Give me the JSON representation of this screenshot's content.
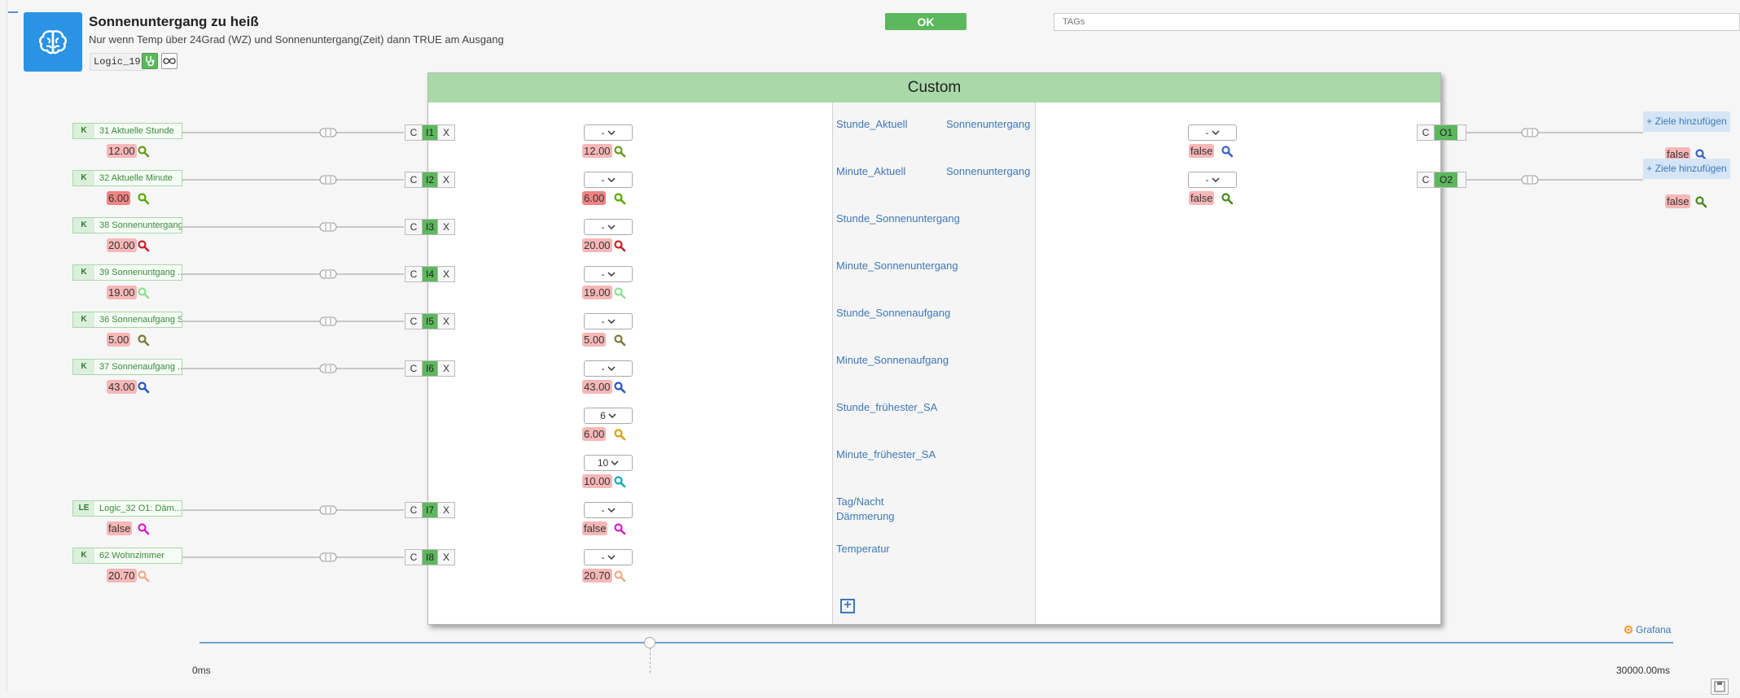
{
  "header": {
    "title": "Sonnenuntergang zu heiß",
    "description": "Nur wenn Temp über 24Grad (WZ) und Sonnenuntergang(Zeit) dann TRUE am Ausgang",
    "logic_id": "Logic_19",
    "ok_label": "OK",
    "tags_placeholder": "TAGs"
  },
  "block": {
    "title": "Custom",
    "add_port_icon": "plus-box-icon"
  },
  "colors": {
    "accent_green": "#5cb85c",
    "header_green": "#a9d9a9",
    "link_blue": "#3f78b8",
    "logo_blue": "#2a93e4",
    "value_pink": "#f7b7b7"
  },
  "inputs": [
    {
      "row": 0,
      "src_type": "K",
      "src_label": "31 Aktuelle Stunde",
      "src_value": "12.00",
      "src_mag": "#6a9a1a",
      "port": "I1",
      "sel": "-",
      "value": "12.00",
      "value_mag": "#6a9a1a",
      "name": "Stunde_Aktuell"
    },
    {
      "row": 1,
      "src_type": "K",
      "src_label": "32 Aktuelle Minute",
      "src_value": "6.00",
      "src_mag": "#5aa800",
      "src_red": true,
      "port": "I2",
      "sel": "-",
      "value": "6.00",
      "value_mag": "#5aa800",
      "value_red": true,
      "name": "Minute_Aktuell"
    },
    {
      "row": 2,
      "src_type": "K",
      "src_label": "38 Sonnenuntergang...",
      "src_value": "20.00",
      "src_mag": "#c8202a",
      "port": "I3",
      "sel": "-",
      "value": "20.00",
      "value_mag": "#c8202a",
      "name": "Stunde_Sonnenuntergang"
    },
    {
      "row": 3,
      "src_type": "K",
      "src_label": "39 Sonnenuntgang ...",
      "src_value": "19.00",
      "src_mag": "#8ee08e",
      "port": "I4",
      "sel": "-",
      "value": "19.00",
      "value_mag": "#8ee08e",
      "name": "Minute_Sonnenuntergang"
    },
    {
      "row": 4,
      "src_type": "K",
      "src_label": "36 Sonnenaufgang S...",
      "src_value": "5.00",
      "src_mag": "#7d7a3a",
      "port": "I5",
      "sel": "-",
      "value": "5.00",
      "value_mag": "#7d7a3a",
      "name": "Stunde_Sonnenaufgang"
    },
    {
      "row": 5,
      "src_type": "K",
      "src_label": "37 Sonnenaufgang ...",
      "src_value": "43.00",
      "src_mag": "#2a52c8",
      "port": "I6",
      "sel": "-",
      "value": "43.00",
      "value_mag": "#2a52c8",
      "name": "Minute_Sonnenaufgang"
    },
    {
      "row": 6,
      "sel": "6",
      "value": "6.00",
      "value_mag": "#d8a020",
      "name": "Stunde_frühester_SA"
    },
    {
      "row": 7,
      "sel": "10",
      "value": "10.00",
      "value_mag": "#18a8b8",
      "name": "Minute_frühester_SA"
    },
    {
      "row": 8,
      "src_type": "LE",
      "src_label": "Logic_32 O1: Däm...",
      "src_value": "false",
      "src_mag": "#d020c8",
      "port": "I7",
      "sel": "-",
      "value": "false",
      "value_mag": "#d020c8",
      "name": "Tag/Nacht",
      "name2": "Dämmerung"
    },
    {
      "row": 9,
      "src_type": "K",
      "src_label": "62 Wohnzimmer",
      "src_value": "20.70",
      "src_mag": "#f0a888",
      "port": "I8",
      "sel": "-",
      "value": "20.70",
      "value_mag": "#f0a888",
      "name": "Temperatur"
    }
  ],
  "outputs": [
    {
      "row": 0,
      "name": "Sonnenuntergang",
      "sel": "-",
      "value": "false",
      "value_mag": "#3a62c0",
      "port": "O1",
      "target_label": "+ Ziele hinzufügen",
      "target_value": "false",
      "target_mag": "#3a62c0"
    },
    {
      "row": 1,
      "name": "Sonnenuntergang",
      "sel": "-",
      "value": "false",
      "value_mag": "#4a8a1a",
      "port": "O2",
      "target_label": "+ Ziele hinzufügen",
      "target_value": "false",
      "target_mag": "#4a8a1a"
    }
  ],
  "timeline": {
    "start": "0ms",
    "end": "30000.00ms",
    "grafana": "Grafana"
  }
}
